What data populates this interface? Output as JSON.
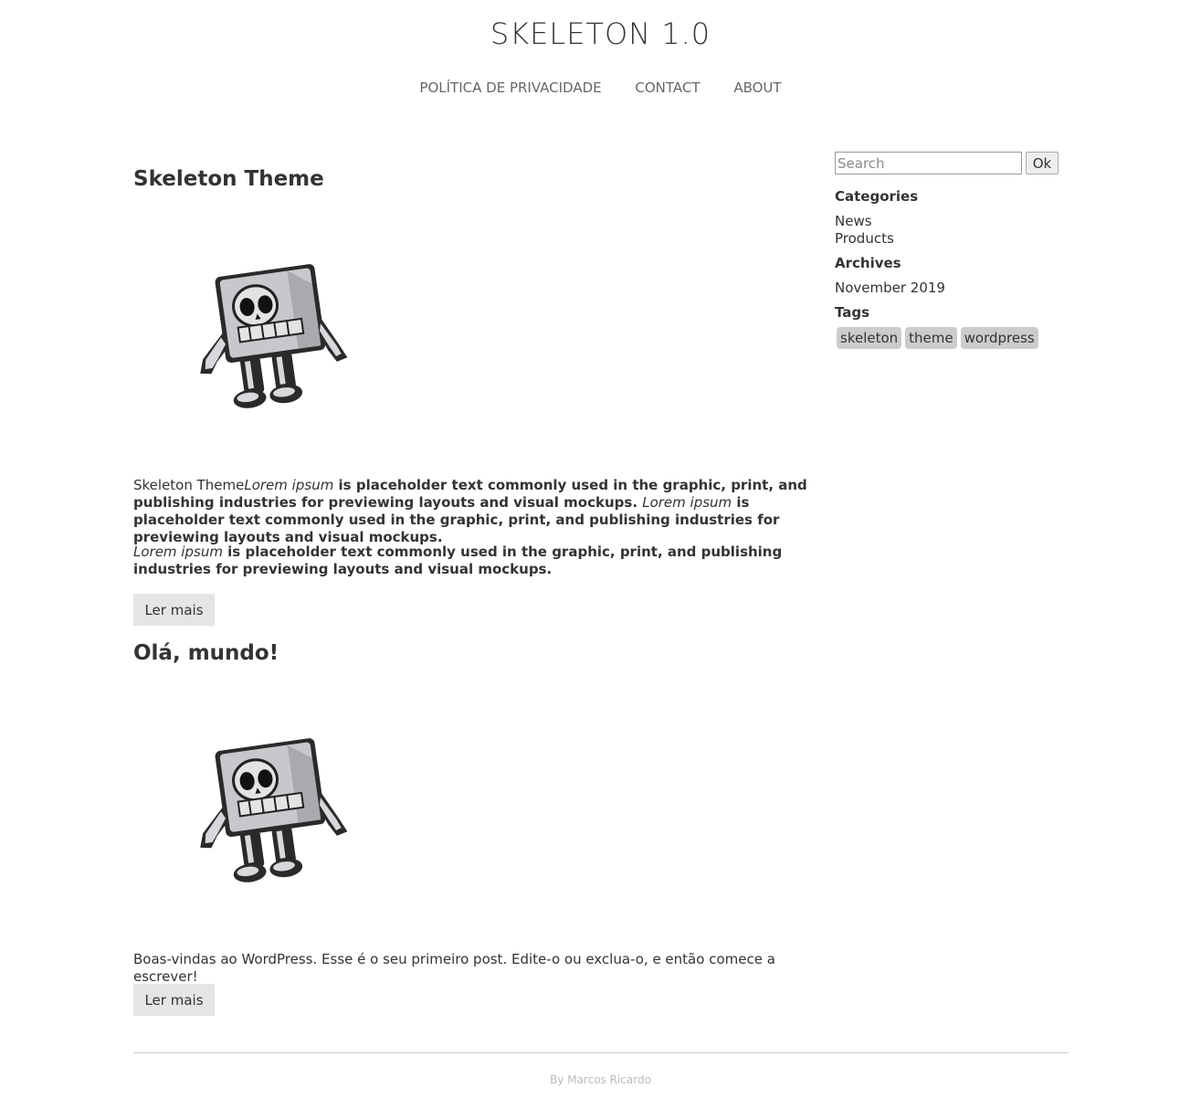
{
  "site": {
    "title": "SKELETON 1.0"
  },
  "nav": {
    "items": [
      "POLÍTICA DE PRIVACIDADE",
      "CONTACT",
      "ABOUT"
    ]
  },
  "posts": [
    {
      "title": "Skeleton Theme",
      "intro_plain": "Skeleton Theme",
      "para1": [
        {
          "t": "Lorem ipsum",
          "s": "i"
        },
        {
          "t": " is placeholder text commonly used in the graphic, print, and publishing industries for previewing layouts and visual mockups. ",
          "s": "b"
        },
        {
          "t": "Lorem ipsum",
          "s": "i"
        },
        {
          "t": " is placeholder text commonly used in the graphic, print, and publishing industries for previewing layouts and visual mockups.",
          "s": "b"
        }
      ],
      "para2": [
        {
          "t": "Lorem ipsum",
          "s": "i"
        },
        {
          "t": " is placeholder text commonly used in the graphic, print, and publishing industries for previewing layouts and visual mockups.",
          "s": "b"
        }
      ],
      "read_more": "Ler mais"
    },
    {
      "title": "Olá, mundo!",
      "text": "Boas-vindas ao WordPress. Esse é o seu primeiro post. Edite-o ou exclua-o, e então comece a escrever!",
      "read_more": "Ler mais"
    }
  ],
  "sidebar": {
    "search_placeholder": "Search",
    "search_button": "Ok",
    "categories_title": "Categories",
    "categories": [
      "News",
      "Products"
    ],
    "archives_title": "Archives",
    "archives": [
      "November 2019"
    ],
    "tags_title": "Tags",
    "tags": [
      "skeleton",
      "theme",
      "wordpress"
    ]
  },
  "footer": {
    "text": "By Marcos Ricardo"
  }
}
